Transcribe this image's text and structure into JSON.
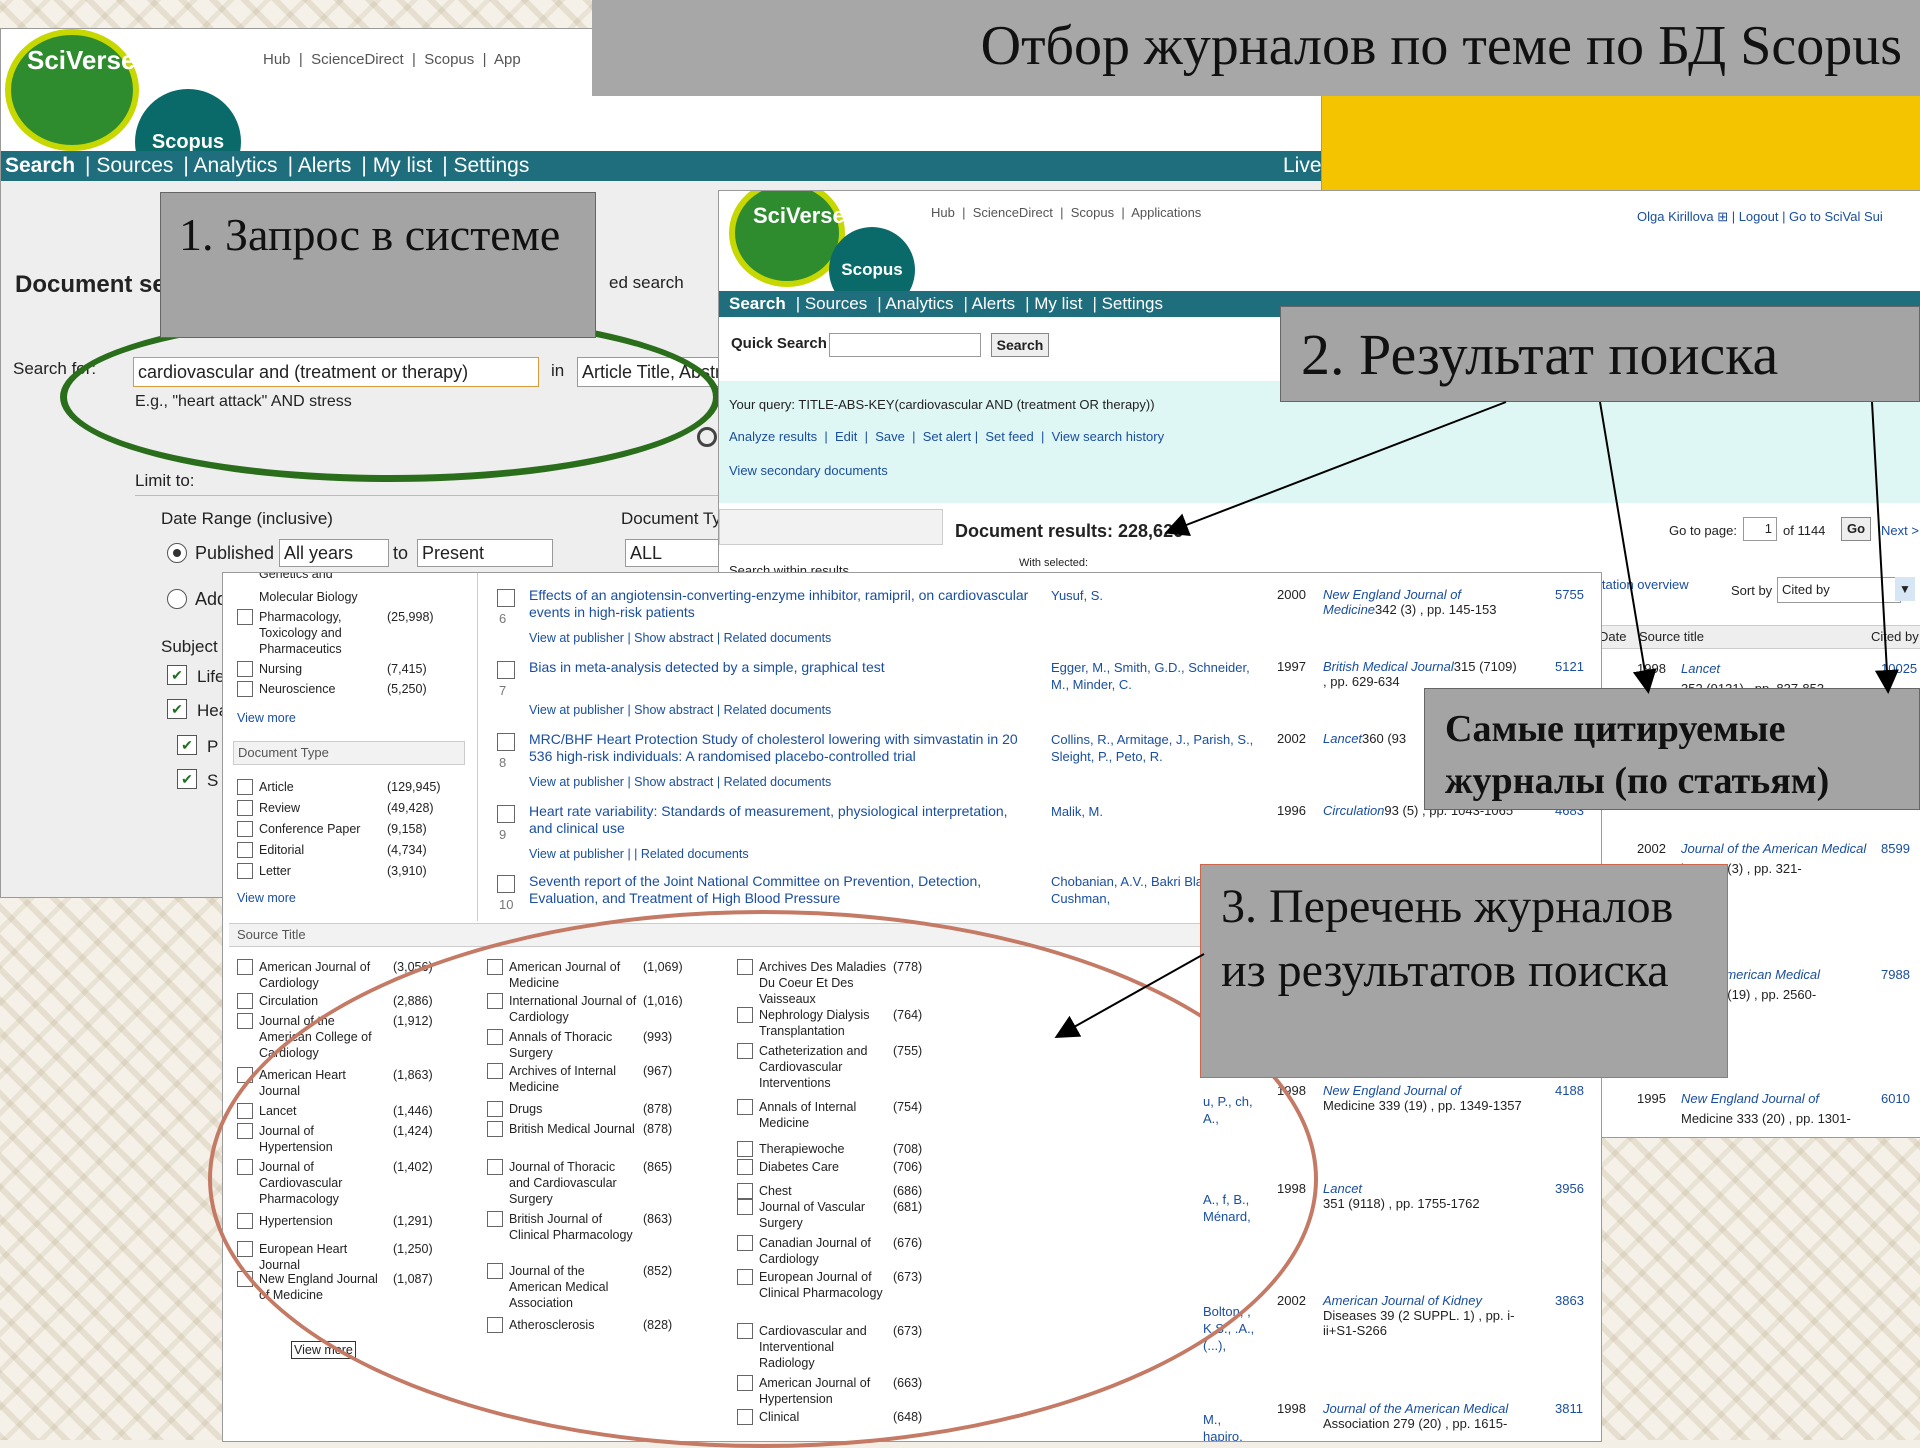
{
  "slide_title": "Отбор журналов по теме по БД Scopus",
  "callouts": {
    "step1": "1. Запрос в системе",
    "step2": "2. Результат поиска",
    "step3": "3. Перечень журналов из результатов поиска",
    "most_cited": "Самые цитируемые журналы (по статьям)"
  },
  "brand": {
    "sciverse": "SciVerse",
    "scopus": "Scopus"
  },
  "top_links": [
    "Hub",
    "ScienceDirect",
    "Scopus",
    "App"
  ],
  "top_links2": [
    "Hub",
    "ScienceDirect",
    "Scopus",
    "Applications"
  ],
  "nav": [
    "Search",
    "Sources",
    "Analytics",
    "Alerts",
    "My list",
    "Settings"
  ],
  "nav_right": "Live",
  "user_bar": "Olga Kirillova  ⊞  |  Logout  |  Go to SciVal Sui",
  "search_panel": {
    "heading": "Document se",
    "adv_tab": "ed search",
    "search_for": "Search for:",
    "query": "cardiovascular and (treatment or therapy)",
    "in": "in",
    "field": "Article Title, Abstr",
    "example": "E.g., \"heart attack\" AND stress",
    "limit_to": "Limit to:",
    "date_range": "Date Range (inclusive)",
    "published": "Published",
    "all_years": "All years",
    "to": "to",
    "present": "Present",
    "doc_type": "Document Typ",
    "all": "ALL",
    "added": "Add",
    "subject": "Subject",
    "life": "Life",
    "hea": "Hea",
    "p": "P",
    "s": "S"
  },
  "results": {
    "quick_search": "Quick Search",
    "search_btn": "Search",
    "your_query_label": "Your query:",
    "your_query": "TITLE-ABS-KEY(cardiovascular AND (treatment OR therapy))",
    "actions": [
      "Analyze results",
      "Edit",
      "Save",
      "Set alert",
      "Set feed",
      "View search history"
    ],
    "secondary": "View secondary documents",
    "doc_results": "Document results: 228,626",
    "search_within": "Search within results",
    "goto": "Go to page:",
    "page": "1",
    "of": "of 1144",
    "go": "Go",
    "next": "Next >",
    "with_selected": "With selected:",
    "citation_overview": "itation overview",
    "sort_by": "Sort by",
    "sort_value": "Cited by",
    "col_date": "Date",
    "col_source": "Source title",
    "col_cited": "Cited by",
    "right_rows": [
      {
        "year": "1998",
        "src": "Lancet",
        "detail": "352 (9131) , pp. 837-853",
        "cited": "10025"
      },
      {
        "year": "2002",
        "src": "Journal of the American Medical",
        "detail": "ion 288 (3) , pp. 321-",
        "cited": "8599"
      },
      {
        "year": "",
        "src": "of the American Medical",
        "detail": "ion 289 (19) , pp. 2560-",
        "cited": "7988"
      },
      {
        "year": "1995",
        "src": "New England Journal of",
        "detail": "Medicine 333 (20) , pp. 1301-",
        "cited": "6010"
      }
    ]
  },
  "main_results": [
    {
      "num": "6",
      "title": "Effects of an angiotensin-converting-enzyme inhibitor, ramipril, on cardiovascular events in high-risk patients",
      "authors": "Yusuf, S.",
      "year": "2000",
      "source": "New England Journal of Medicine",
      "detail": "342 (3) , pp. 145-153",
      "cited": "5755"
    },
    {
      "num": "7",
      "title": "Bias in meta-analysis detected by a simple, graphical test",
      "authors": "Egger, M., Smith, G.D., Schneider, M., Minder, C.",
      "year": "1997",
      "source": "British Medical Journal",
      "detail": "315 (7109) , pp. 629-634",
      "cited": "5121"
    },
    {
      "num": "8",
      "title": "MRC/BHF Heart Protection Study of cholesterol lowering with simvastatin in 20 536 high-risk individuals: A randomised placebo-controlled trial",
      "authors": "Collins, R., Armitage, J., Parish, S., Sleight, P., Peto, R.",
      "year": "2002",
      "source": "Lancet",
      "detail": "360 (93",
      "cited": ""
    },
    {
      "num": "9",
      "title": "Heart rate variability: Standards of measurement, physiological interpretation, and clinical use",
      "authors": "Malik, M.",
      "year": "1996",
      "source": "Circulation",
      "detail": "93 (5) , pp. 1043-1065",
      "cited": "4683"
    },
    {
      "num": "10",
      "title": "Seventh report of the Joint National Committee on Prevention, Detection, Evaluation, and Treatment of High Blood Pressure",
      "authors": "Chobanian, A.V., Bakri Black, H.R., Cushman,",
      "year": "",
      "source": "",
      "detail": "",
      "cited": ""
    }
  ],
  "result_links": [
    "View at publisher",
    "Show abstract",
    "Related documents"
  ],
  "lower_results": [
    {
      "authors": "u, P., ch, A.,",
      "year": "1998",
      "source": "New England Journal of",
      "detail": "Medicine 339 (19) , pp. 1349-1357",
      "cited": "4188"
    },
    {
      "authors": "A., f, B., Ménard,",
      "year": "1998",
      "source": "Lancet",
      "detail": "351 (9118) , pp. 1755-1762",
      "cited": "3956"
    },
    {
      "authors": "Bolton, , K.S., .A., (...),",
      "year": "2002",
      "source": "American Journal of Kidney",
      "detail": "Diseases 39 (2 SUPPL. 1) , pp. i-ii+S1-S266",
      "cited": "3863"
    },
    {
      "authors": "M., hapiro,",
      "year": "1998",
      "source": "Journal of the American Medical",
      "detail": "Association 279 (20) , pp. 1615-",
      "cited": "3811"
    }
  ],
  "facets": {
    "subject_top": "Genetics and",
    "subjects": [
      {
        "label": "Molecular Biology",
        "count": ""
      },
      {
        "label": "Pharmacology, Toxicology and Pharmaceutics",
        "count": "(25,998)"
      },
      {
        "label": "Nursing",
        "count": "(7,415)"
      },
      {
        "label": "Neuroscience",
        "count": "(5,250)"
      }
    ],
    "view_more": "View more",
    "doc_type_title": "Document Type",
    "doc_types": [
      {
        "label": "Article",
        "count": "(129,945)"
      },
      {
        "label": "Review",
        "count": "(49,428)"
      },
      {
        "label": "Conference Paper",
        "count": "(9,158)"
      },
      {
        "label": "Editorial",
        "count": "(4,734)"
      },
      {
        "label": "Letter",
        "count": "(3,910)"
      }
    ],
    "source_title": "Source Title",
    "sources_col1": [
      {
        "label": "American Journal of Cardiology",
        "count": "(3,056)"
      },
      {
        "label": "Circulation",
        "count": "(2,886)"
      },
      {
        "label": "Journal of the American College of Cardiology",
        "count": "(1,912)"
      },
      {
        "label": "American Heart Journal",
        "count": "(1,863)"
      },
      {
        "label": "Lancet",
        "count": "(1,446)"
      },
      {
        "label": "Journal of Hypertension",
        "count": "(1,424)"
      },
      {
        "label": "Journal of Cardiovascular Pharmacology",
        "count": "(1,402)"
      },
      {
        "label": "Hypertension",
        "count": "(1,291)"
      },
      {
        "label": "European Heart Journal",
        "count": "(1,250)"
      },
      {
        "label": "New England Journal of Medicine",
        "count": "(1,087)"
      }
    ],
    "sources_col2": [
      {
        "label": "American Journal of Medicine",
        "count": "(1,069)"
      },
      {
        "label": "International Journal of Cardiology",
        "count": "(1,016)"
      },
      {
        "label": "Annals of Thoracic Surgery",
        "count": "(993)"
      },
      {
        "label": "Archives of Internal Medicine",
        "count": "(967)"
      },
      {
        "label": "Drugs",
        "count": "(878)"
      },
      {
        "label": "British Medical Journal",
        "count": "(878)"
      },
      {
        "label": "Journal of Thoracic and Cardiovascular Surgery",
        "count": "(865)"
      },
      {
        "label": "British Journal of Clinical Pharmacology",
        "count": "(863)"
      },
      {
        "label": "Journal of the American Medical Association",
        "count": "(852)"
      },
      {
        "label": "Atherosclerosis",
        "count": "(828)"
      }
    ],
    "sources_col3": [
      {
        "label": "Archives Des Maladies Du Coeur Et Des Vaisseaux",
        "count": "(778)"
      },
      {
        "label": "Nephrology Dialysis Transplantation",
        "count": "(764)"
      },
      {
        "label": "Catheterization and Cardiovascular Interventions",
        "count": "(755)"
      },
      {
        "label": "Annals of Internal Medicine",
        "count": "(754)"
      },
      {
        "label": "Therapiewoche",
        "count": "(708)"
      },
      {
        "label": "Diabetes Care",
        "count": "(706)"
      },
      {
        "label": "Chest",
        "count": "(686)"
      },
      {
        "label": "Journal of Vascular Surgery",
        "count": "(681)"
      },
      {
        "label": "Canadian Journal of Cardiology",
        "count": "(676)"
      },
      {
        "label": "European Journal of Clinical Pharmacology",
        "count": "(673)"
      },
      {
        "label": "Cardiovascular and Interventional Radiology",
        "count": "(673)"
      },
      {
        "label": "American Journal of Hypertension",
        "count": "(663)"
      },
      {
        "label": "Clinical",
        "count": "(648)"
      }
    ],
    "view_more_btn": "View more"
  },
  "colors": {
    "teal_nav": "#1f6e7e",
    "callout_gray": "#a4a4a4",
    "yellow": "#f5c400",
    "ellipse_green": "#2a6e1c",
    "ellipse_red": "#c47a64",
    "light_cyan": "#dff7f4"
  }
}
